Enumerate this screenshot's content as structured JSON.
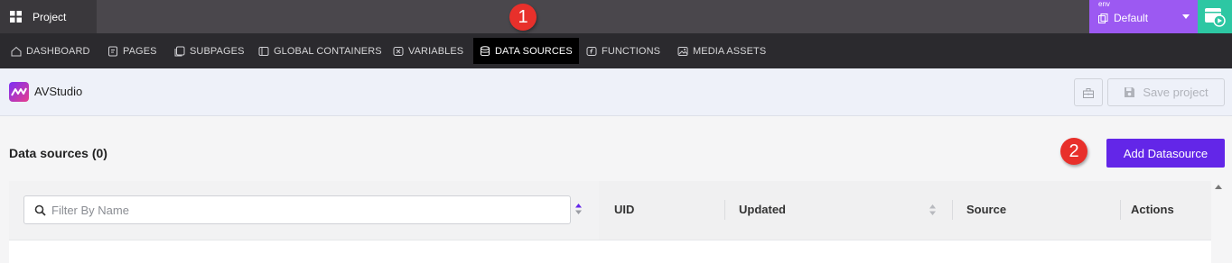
{
  "topbar": {
    "project_label": "Project",
    "env_small_label": "env",
    "env_value": "Default"
  },
  "nav": {
    "items": [
      {
        "label": "DASHBOARD",
        "icon": "home-icon"
      },
      {
        "label": "PAGES",
        "icon": "page-icon"
      },
      {
        "label": "SUBPAGES",
        "icon": "subpage-icon"
      },
      {
        "label": "GLOBAL CONTAINERS",
        "icon": "container-icon"
      },
      {
        "label": "VARIABLES",
        "icon": "variable-icon"
      },
      {
        "label": "DATA SOURCES",
        "icon": "database-icon",
        "active": true
      },
      {
        "label": "FUNCTIONS",
        "icon": "function-icon"
      },
      {
        "label": "MEDIA ASSETS",
        "icon": "image-icon"
      }
    ]
  },
  "subheader": {
    "brand": "AVStudio",
    "save_label": "Save project"
  },
  "content": {
    "title": "Data sources (0)",
    "add_button": "Add Datasource",
    "filter_placeholder": "Filter By Name",
    "columns": [
      "UID",
      "Updated",
      "Source",
      "Actions"
    ]
  },
  "annotations": [
    "1",
    "2"
  ],
  "colors": {
    "nav_bg": "#2b2a2e",
    "env_bg": "#9c59f2",
    "preview_bg": "#2dc7a3",
    "primary": "#6326e8",
    "marker": "#e8302b"
  }
}
